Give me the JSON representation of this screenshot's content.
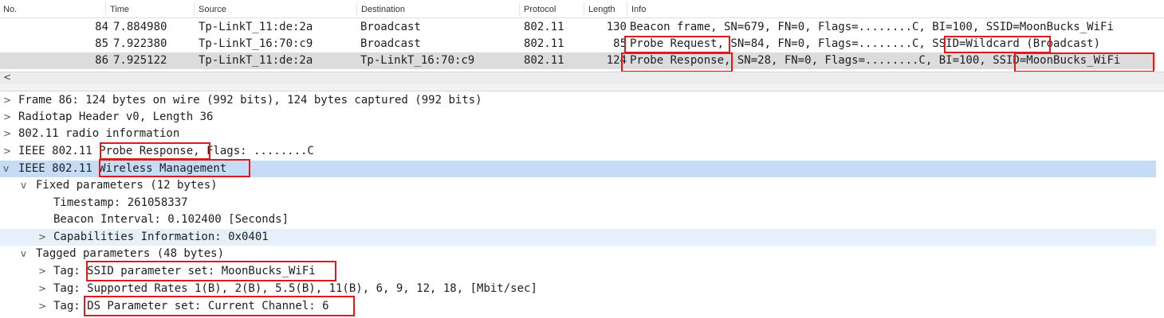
{
  "packet_list": {
    "headers": [
      "No.",
      "Time",
      "Source",
      "Destination",
      "Protocol",
      "Length",
      "Info"
    ],
    "rows": [
      {
        "no": "84",
        "time": "7.884980",
        "source": "Tp-LinkT_11:de:2a",
        "destination": "Broadcast",
        "protocol": "802.11",
        "length": "130",
        "info": "Beacon frame, SN=679, FN=0, Flags=........C, BI=100, SSID=MoonBucks_WiFi"
      },
      {
        "no": "85",
        "time": "7.922380",
        "source": "Tp-LinkT_16:70:c9",
        "destination": "Broadcast",
        "protocol": "802.11",
        "length": "85",
        "info": "Probe Request, SN=84, FN=0, Flags=........C, SSID=Wildcard (Broadcast)"
      },
      {
        "no": "86",
        "time": "7.925122",
        "source": "Tp-LinkT_11:de:2a",
        "destination": "Tp-LinkT_16:70:c9",
        "protocol": "802.11",
        "length": "124",
        "info": "Probe Response, SN=28, FN=0, Flags=........C, BI=100, SSID=MoonBucks_WiFi"
      }
    ]
  },
  "scrollbar": {
    "left_arrow": "<"
  },
  "detail_tree": [
    {
      "expander": ">",
      "text": "Frame 86: 124 bytes on wire (992 bits), 124 bytes captured (992 bits)"
    },
    {
      "expander": ">",
      "text": "Radiotap Header v0, Length 36"
    },
    {
      "expander": ">",
      "text": "802.11 radio information"
    },
    {
      "expander": ">",
      "text": "IEEE 802.11 Probe Response, Flags: ........C"
    },
    {
      "expander": "v",
      "text": "IEEE 802.11 Wireless Management"
    },
    {
      "expander": "v",
      "text": "Fixed parameters (12 bytes)"
    },
    {
      "expander": "",
      "text": "Timestamp: 261058337"
    },
    {
      "expander": "",
      "text": "Beacon Interval: 0.102400 [Seconds]"
    },
    {
      "expander": ">",
      "text": "Capabilities Information: 0x0401"
    },
    {
      "expander": "v",
      "text": "Tagged parameters (48 bytes)"
    },
    {
      "expander": ">",
      "text": "Tag: SSID parameter set: MoonBucks_WiFi"
    },
    {
      "expander": ">",
      "text": "Tag: Supported Rates 1(B), 2(B), 5.5(B), 11(B), 6, 9, 12, 18, [Mbit/sec]"
    },
    {
      "expander": ">",
      "text": "Tag: DS Parameter set: Current Channel: 6"
    }
  ],
  "colors": {
    "selected_packet": "#dcdcdc",
    "selected_tree": "#c6dcf5",
    "highlight_box": "#e0191f"
  }
}
